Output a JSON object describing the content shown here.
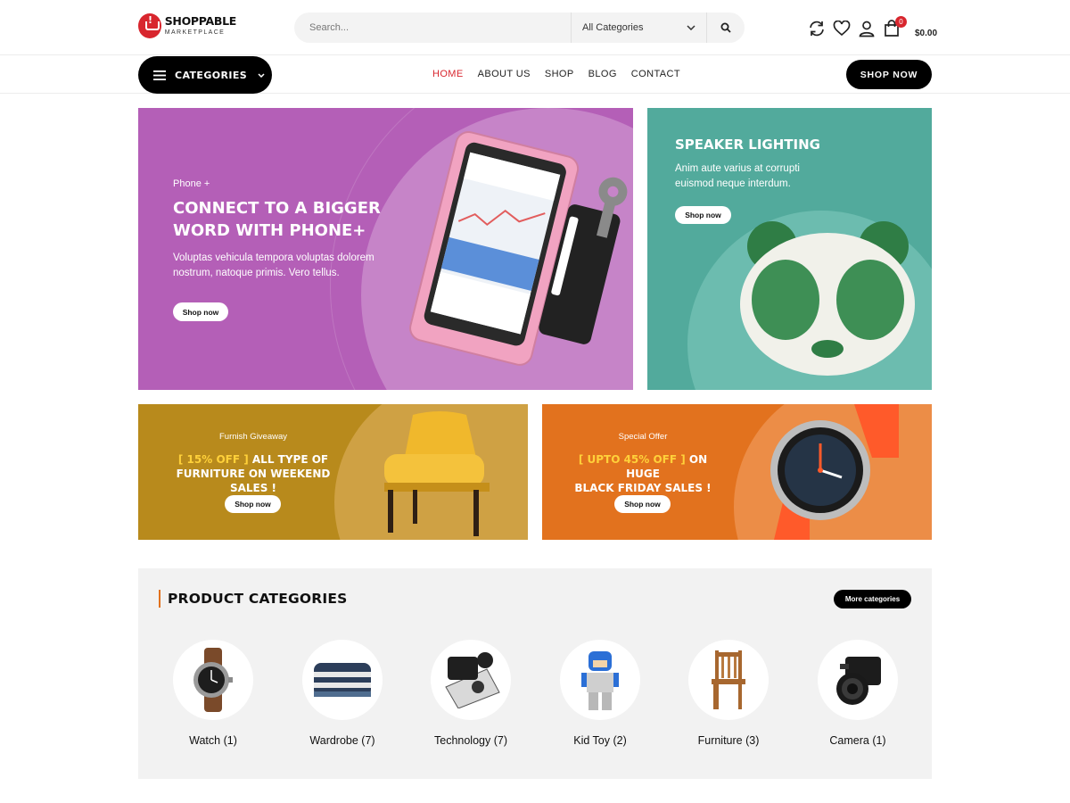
{
  "header": {
    "logo_main": "SHOPPABLE",
    "logo_sub": "MARKETPLACE",
    "search_placeholder": "Search...",
    "category_select": "All Categories",
    "cart_count": "0",
    "cart_total": "$0.00"
  },
  "nav": {
    "categories_label": "CATEGORIES",
    "items": [
      "HOME",
      "ABOUT US",
      "SHOP",
      "BLOG",
      "CONTACT"
    ],
    "active": "HOME",
    "shop_now": "SHOP NOW"
  },
  "banners": {
    "phone": {
      "small": "Phone +",
      "title_line1": "CONNECT TO A BIGGER",
      "title_line2": "WORD WITH PHONE+",
      "desc": "Voluptas vehicula tempora voluptas dolorem nostrum, natoque primis. Vero tellus.",
      "button": "Shop now"
    },
    "speaker": {
      "title": "SPEAKER LIGHTING",
      "desc": "Anim aute varius at corrupti euismod neque interdum.",
      "button": "Shop now"
    },
    "furnish": {
      "small": "Furnish Giveaway",
      "highlight": "[ 15% OFF ]",
      "title_rest": " ALL TYPE OF",
      "title_line2": "FURNITURE ON WEEKEND SALES !",
      "button": "Shop now"
    },
    "special": {
      "small": "Special Offer",
      "highlight": "[ UPTO 45% OFF ]",
      "title_rest": " ON HUGE",
      "title_line2": "BLACK FRIDAY SALES !",
      "button": "Shop now"
    }
  },
  "product_categories": {
    "title": "PRODUCT CATEGORIES",
    "more_button": "More categories",
    "items": [
      {
        "label": "Watch (1)",
        "icon": "watch-icon"
      },
      {
        "label": "Wardrobe (7)",
        "icon": "sweater-icon"
      },
      {
        "label": "Technology (7)",
        "icon": "device-icon"
      },
      {
        "label": "Kid Toy (2)",
        "icon": "toy-icon"
      },
      {
        "label": "Furniture (3)",
        "icon": "chair-icon"
      },
      {
        "label": "Camera (1)",
        "icon": "camera-icon"
      }
    ]
  },
  "colors": {
    "accent": "#d8262e",
    "purple": "#b45fb7",
    "teal": "#52aa9c",
    "mustard": "#b88a1c",
    "orange": "#e2721e",
    "highlight": "#ffd13a"
  }
}
